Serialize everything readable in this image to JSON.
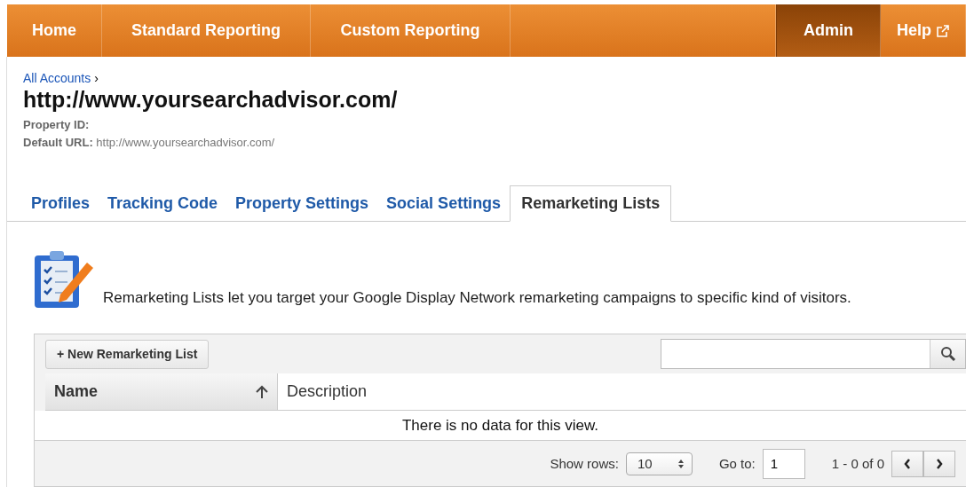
{
  "nav": {
    "left_items": [
      {
        "label": "Home",
        "selected": false
      },
      {
        "label": "Standard Reporting",
        "selected": false
      },
      {
        "label": "Custom Reporting",
        "selected": false
      }
    ],
    "right_items": [
      {
        "label": "Admin",
        "selected": true,
        "external": false
      },
      {
        "label": "Help",
        "selected": false,
        "external": true
      }
    ]
  },
  "breadcrumb": {
    "link": "All Accounts",
    "separator": "›"
  },
  "title": "http://www.yoursearchadvisor.com/",
  "properties": [
    {
      "label": "Property ID:"
    },
    {
      "label": "Default URL:",
      "value": "http://www.yoursearchadvisor.com/"
    }
  ],
  "tabs": [
    {
      "label": "Profiles",
      "selected": false
    },
    {
      "label": "Tracking Code",
      "selected": false
    },
    {
      "label": "Property Settings",
      "selected": false
    },
    {
      "label": "Social Settings",
      "selected": false
    },
    {
      "label": "Remarketing Lists",
      "selected": true
    }
  ],
  "intro": "Remarketing Lists let you target your Google Display Network remarketing campaigns to specific kind of visitors.",
  "table": {
    "new_button": "+ New Remarketing List",
    "columns": [
      {
        "label": "Name",
        "sorted": true
      },
      {
        "label": "Description",
        "sorted": false
      }
    ],
    "empty_message": "There is no data for this view.",
    "footer": {
      "show_rows_label": "Show rows:",
      "show_rows_value": "10",
      "goto_label": "Go to:",
      "goto_value": "1",
      "range": "1 - 0 of 0"
    }
  }
}
